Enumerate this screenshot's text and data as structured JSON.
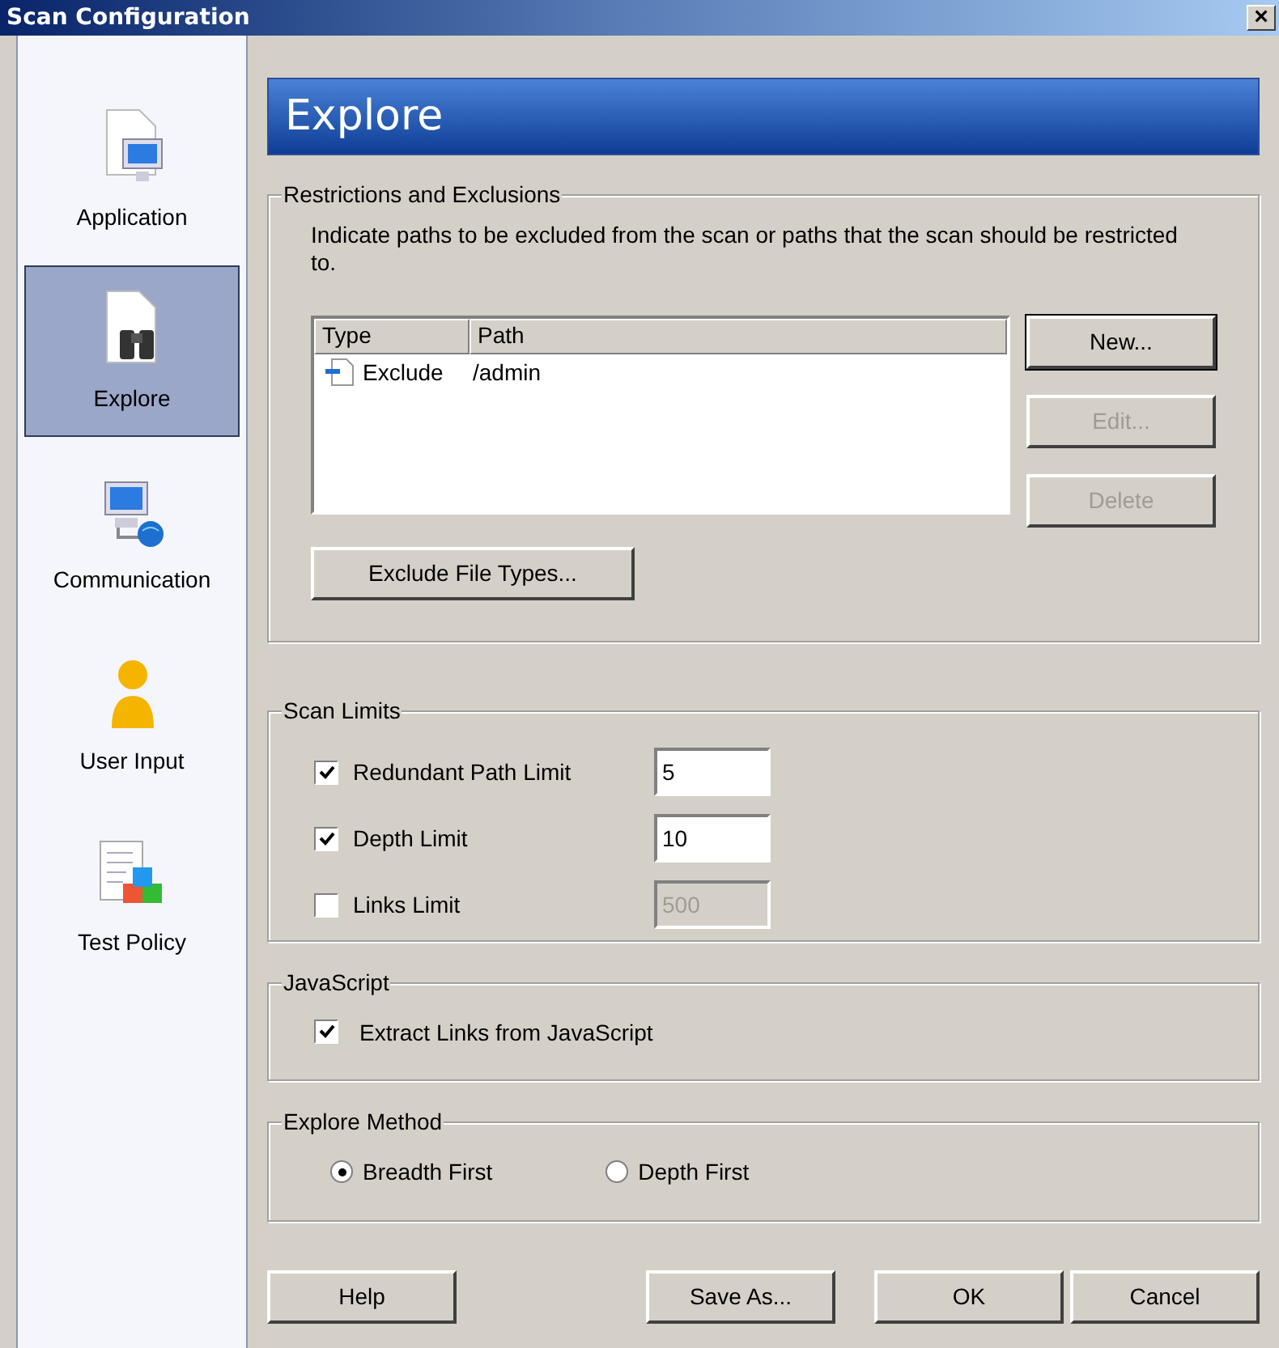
{
  "window": {
    "title": "Scan Configuration",
    "close": "×"
  },
  "sidebar": {
    "items": [
      {
        "label": "Application",
        "kind": "application",
        "selected": false
      },
      {
        "label": "Explore",
        "kind": "explore",
        "selected": true
      },
      {
        "label": "Communication",
        "kind": "communication",
        "selected": false
      },
      {
        "label": "User Input",
        "kind": "user",
        "selected": false
      },
      {
        "label": "Test Policy",
        "kind": "policy",
        "selected": false
      }
    ]
  },
  "header": "Explore",
  "restrictions": {
    "title": "Restrictions and Exclusions",
    "description": "Indicate paths to be excluded from the scan or paths that the scan should be restricted to.",
    "table": {
      "columns": [
        {
          "label": "Type"
        },
        {
          "label": "Path"
        }
      ],
      "rows": [
        {
          "type": "Exclude",
          "path": "/admin"
        }
      ]
    },
    "buttons": [
      {
        "label": "New...",
        "disabled": false,
        "default": true
      },
      {
        "label": "Edit...",
        "disabled": true,
        "default": false
      },
      {
        "label": "Delete",
        "disabled": true,
        "default": false
      }
    ],
    "file_types_button": {
      "label": "Exclude File Types..."
    }
  },
  "scan_limits": {
    "title": "Scan Limits",
    "items": [
      {
        "label": "Redundant Path Limit",
        "checked": true,
        "value": "5"
      },
      {
        "label": "Depth Limit",
        "checked": true,
        "value": "10"
      },
      {
        "label": "Links Limit",
        "checked": false,
        "value": "500"
      }
    ]
  },
  "javascript": {
    "title": "JavaScript",
    "option": {
      "label": "Extract Links from JavaScript",
      "checked": true
    }
  },
  "explore_method": {
    "title": "Explore Method",
    "options": [
      {
        "label": "Breadth First",
        "selected": true
      },
      {
        "label": "Depth First",
        "selected": false
      }
    ]
  },
  "footer": {
    "left": [
      {
        "label": "Help"
      }
    ],
    "right": [
      {
        "label": "Save As..."
      },
      {
        "label": "OK"
      },
      {
        "label": "Cancel"
      }
    ]
  }
}
